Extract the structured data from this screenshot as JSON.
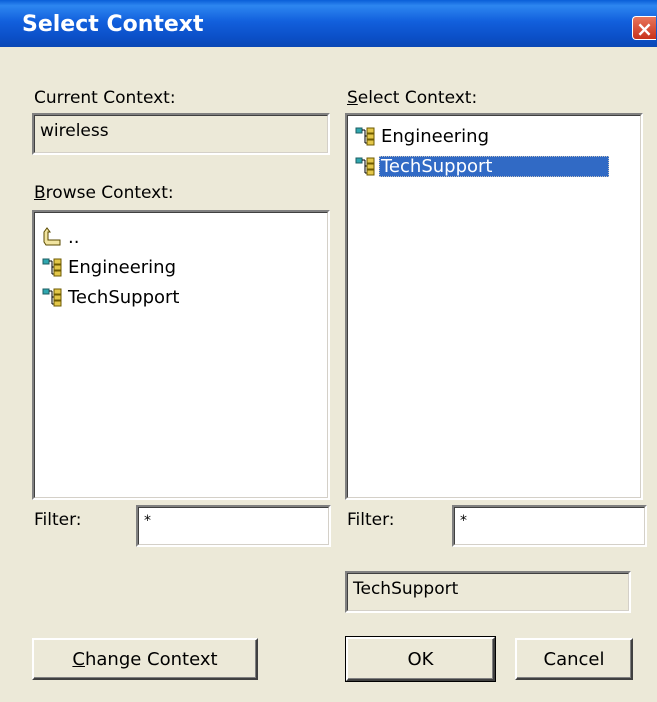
{
  "window": {
    "title": "Select Context",
    "close_icon": "×"
  },
  "current_context": {
    "label": "Current Context:",
    "value": "wireless"
  },
  "browse_context": {
    "label_prefix": "",
    "label_hotkey": "B",
    "label_rest": "rowse Context:",
    "items": [
      {
        "label": "..",
        "icon": "up-folder-icon"
      },
      {
        "label": "Engineering",
        "icon": "tree-node-icon"
      },
      {
        "label": "TechSupport",
        "icon": "tree-node-icon"
      }
    ],
    "filter_label": "Filter:",
    "filter_value": "*"
  },
  "select_context": {
    "label_hotkey": "S",
    "label_rest": "elect Context:",
    "items": [
      {
        "label": "Engineering",
        "icon": "tree-node-icon",
        "selected": false
      },
      {
        "label": "TechSupport",
        "icon": "tree-node-icon",
        "selected": true
      }
    ],
    "filter_label": "Filter:",
    "filter_value": "*",
    "selected_value": "TechSupport"
  },
  "buttons": {
    "change_context_hotkey": "C",
    "change_context_rest": "hange Context",
    "ok": "OK",
    "cancel": "Cancel"
  }
}
